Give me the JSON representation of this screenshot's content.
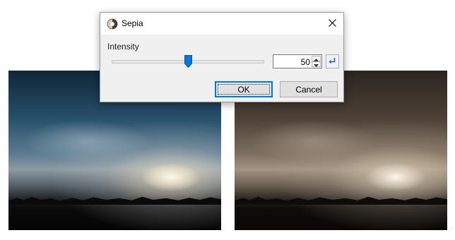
{
  "dialog": {
    "title": "Sepia",
    "app_icon": "sepia-app-icon",
    "close_icon": "close-icon",
    "intensity_label": "Intensity",
    "slider": {
      "value": 50,
      "min": 0,
      "max": 100
    },
    "spin_value": "50",
    "spin_up_icon": "chevron-up-icon",
    "spin_down_icon": "chevron-down-icon",
    "reset_icon": "undo-arrow-icon",
    "ok_label": "OK",
    "cancel_label": "Cancel"
  },
  "colors": {
    "accent": "#0078d7",
    "reset_arrow": "#1e64b4"
  }
}
